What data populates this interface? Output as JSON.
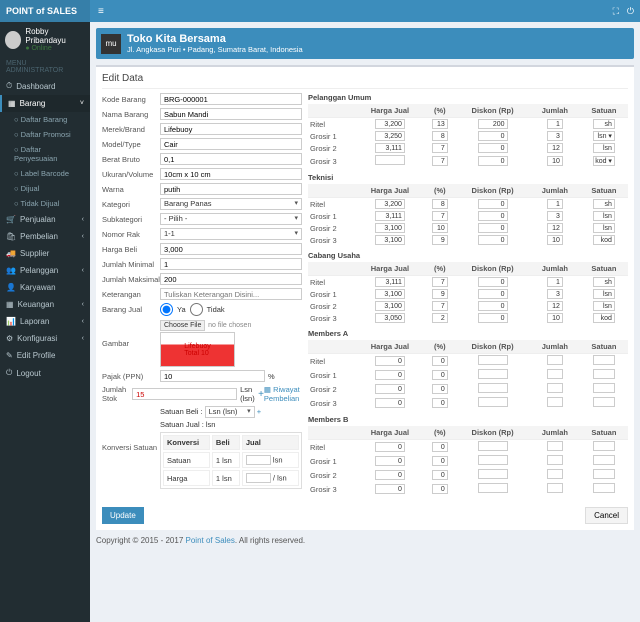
{
  "brand": "POINT of SALES",
  "user": {
    "name": "Robby Pribandayu",
    "status": "● Online"
  },
  "menuheader": "MENU ADMINISTRATOR",
  "nav": {
    "dashboard": "Dashboard",
    "barang": "Barang",
    "sub": {
      "daftar_barang": "Daftar Barang",
      "daftar_promosi": "Daftar Promosi",
      "daftar_penyesuaian": "Daftar Penyesuaian",
      "label_barcode": "Label Barcode",
      "dijual": "Dijual",
      "tidak_dijual": "Tidak Dijual"
    },
    "penjualan": "Penjualan",
    "pembelian": "Pembelian",
    "supplier": "Supplier",
    "pelanggan": "Pelanggan",
    "karyawan": "Karyawan",
    "keuangan": "Keuangan",
    "laporan": "Laporan",
    "konfigurasi": "Konfigurasi",
    "edit_profile": "Edit Profile",
    "logout": "Logout"
  },
  "company": {
    "name": "Toko Kita Bersama",
    "addr": "Jl. Angkasa Puri • Padang, Sumatra Barat, Indonesia",
    "logo": "mu"
  },
  "boxtitle": "Edit Data",
  "labels": {
    "kode": "Kode Barang",
    "nama": "Nama Barang",
    "merek": "Merek/Brand",
    "model": "Model/Type",
    "berat": "Berat Bruto",
    "ukuran": "Ukuran/Volume",
    "warna": "Warna",
    "kategori": "Kategori",
    "subkategori": "Subkategori",
    "nomor_rak": "Nomor Rak",
    "harga_beli": "Harga Beli",
    "jumlah_minimal": "Jumlah Minimal",
    "jumlah_maksimal": "Jumlah Maksimal",
    "keterangan": "Keterangan",
    "barang_jual": "Barang Jual",
    "gambar": "Gambar",
    "pajak": "Pajak (PPN)",
    "jumlah_stok": "Jumlah Stok",
    "konversi": "Konversi Satuan"
  },
  "form": {
    "kode": "BRG-000001",
    "nama": "Sabun Mandi",
    "merek": "Lifebuoy",
    "model": "Cair",
    "berat": "0,1",
    "ukuran": "10cm x 10 cm",
    "warna": "putih",
    "kategori": "Barang Panas",
    "subkategori": "- Pilih -",
    "nomor_rak": "1-1",
    "harga_beli": "3,000",
    "jumlah_minimal": "1",
    "jumlah_maksimal": "200",
    "keterangan": "Tuliskan Keterangan Disini...",
    "pajak": "10",
    "pajak_unit": "%",
    "stok": "15",
    "stok_unit1": "Lsn (lsn)",
    "stok_unit2": "Lsn (lsn)",
    "konv_beli": "Lsn (lsn)",
    "riwayat": "Riwayat Pembelian",
    "choose": "Choose File",
    "nofile": "no file chosen",
    "ya": "Ya",
    "tidak": "Tidak",
    "satuan_jual": "Satuan Jual : lsn",
    "satuan_beli": "Satuan Beli :"
  },
  "conv": {
    "h_konversi": "Konversi",
    "h_beli": "Beli",
    "h_jual": "Jual",
    "satuan": "Satuan",
    "harga": "Harga",
    "v_satuan": "1 lsn",
    "v_jual_unit": "lsn",
    "v_harga": "1 lsn",
    "v_harga_unit": "/ lsn"
  },
  "priceheaders": {
    "harga": "Harga Jual",
    "persen": "(%)",
    "diskon": "Diskon (Rp)",
    "jumlah": "Jumlah",
    "satuan": "Satuan"
  },
  "rowlabels": {
    "ritel": "Ritel",
    "g1": "Grosir 1",
    "g2": "Grosir 2",
    "g3": "Grosir 3"
  },
  "sections": [
    {
      "title": "Pelanggan Umum",
      "rows": [
        [
          "3,200",
          "13",
          "200",
          "1",
          "sh"
        ],
        [
          "3,250",
          "8",
          "0",
          "3",
          "lsn ▾"
        ],
        [
          "3,111",
          "7",
          "0",
          "12",
          "lsn"
        ],
        [
          "",
          "7",
          "0",
          "10",
          "kod ▾"
        ]
      ]
    },
    {
      "title": "Teknisi",
      "rows": [
        [
          "3,200",
          "8",
          "0",
          "1",
          "sh"
        ],
        [
          "3,111",
          "7",
          "0",
          "3",
          "lsn"
        ],
        [
          "3,100",
          "10",
          "0",
          "12",
          "lsn"
        ],
        [
          "3,100",
          "9",
          "0",
          "10",
          "kod"
        ]
      ]
    },
    {
      "title": "Cabang Usaha",
      "rows": [
        [
          "3,111",
          "7",
          "0",
          "1",
          "sh"
        ],
        [
          "3,100",
          "9",
          "0",
          "3",
          "lsn"
        ],
        [
          "3,100",
          "7",
          "0",
          "12",
          "lsn"
        ],
        [
          "3,050",
          "2",
          "0",
          "10",
          "kod"
        ]
      ]
    },
    {
      "title": "Members A",
      "rows": [
        [
          "0",
          "0",
          "",
          "",
          ""
        ],
        [
          "0",
          "0",
          "",
          "",
          ""
        ],
        [
          "0",
          "0",
          "",
          "",
          ""
        ],
        [
          "0",
          "0",
          "",
          "",
          ""
        ]
      ]
    },
    {
      "title": "Members B",
      "rows": [
        [
          "0",
          "0",
          "",
          "",
          ""
        ],
        [
          "0",
          "0",
          "",
          "",
          ""
        ],
        [
          "0",
          "0",
          "",
          "",
          ""
        ],
        [
          "0",
          "0",
          "",
          "",
          ""
        ]
      ]
    }
  ],
  "btn": {
    "update": "Update",
    "cancel": "Cancel"
  },
  "footer": {
    "copy": "Copyright © 2015 - 2017 ",
    "link": "Point of Sales",
    "rest": ". All rights reserved."
  }
}
